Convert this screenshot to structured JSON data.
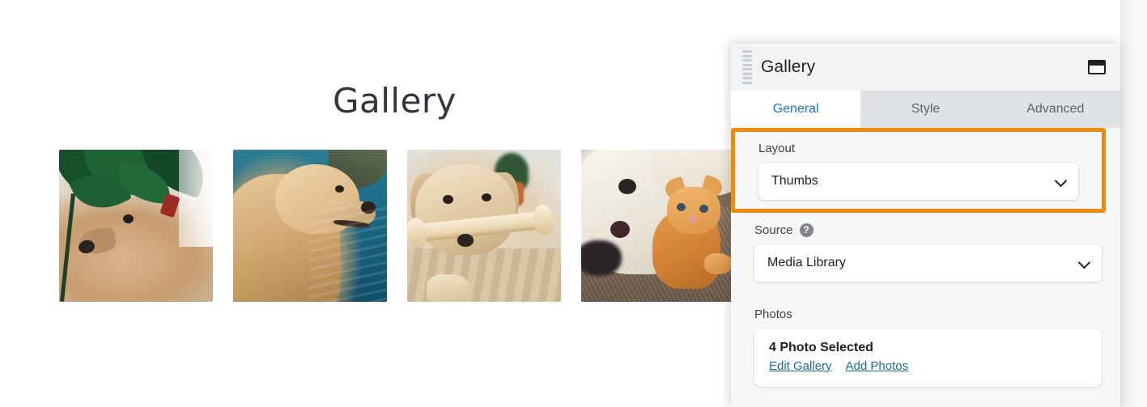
{
  "canvas": {
    "heading": "Gallery",
    "photos": [
      {
        "alt": "Golden retriever under monstera leaves on a patio"
      },
      {
        "alt": "Golden retriever looking out over blue sea water"
      },
      {
        "alt": "Golden retriever lying down holding a bone treat"
      },
      {
        "alt": "White dog and ginger kitten resting on a brown rug"
      }
    ]
  },
  "panel": {
    "title": "Gallery",
    "drag_handle_icon": "drag-handle-icon",
    "window_icon": "window-layout-icon",
    "tabs": [
      {
        "label": "General",
        "active": true
      },
      {
        "label": "Style",
        "active": false
      },
      {
        "label": "Advanced",
        "active": false
      }
    ],
    "highlight_color": "#ef8a0c",
    "accent_color": "#1a73c8",
    "link_color": "#1b6a9c",
    "layout": {
      "label": "Layout",
      "value": "Thumbs",
      "chevron_icon": "chevron-down-icon"
    },
    "source": {
      "label": "Source",
      "help_icon": "help-icon",
      "help_glyph": "?",
      "value": "Media Library",
      "chevron_icon": "chevron-down-icon"
    },
    "photos": {
      "label": "Photos",
      "count_text": "4 Photo Selected",
      "edit_link": "Edit Gallery",
      "add_link": "Add Photos"
    }
  }
}
